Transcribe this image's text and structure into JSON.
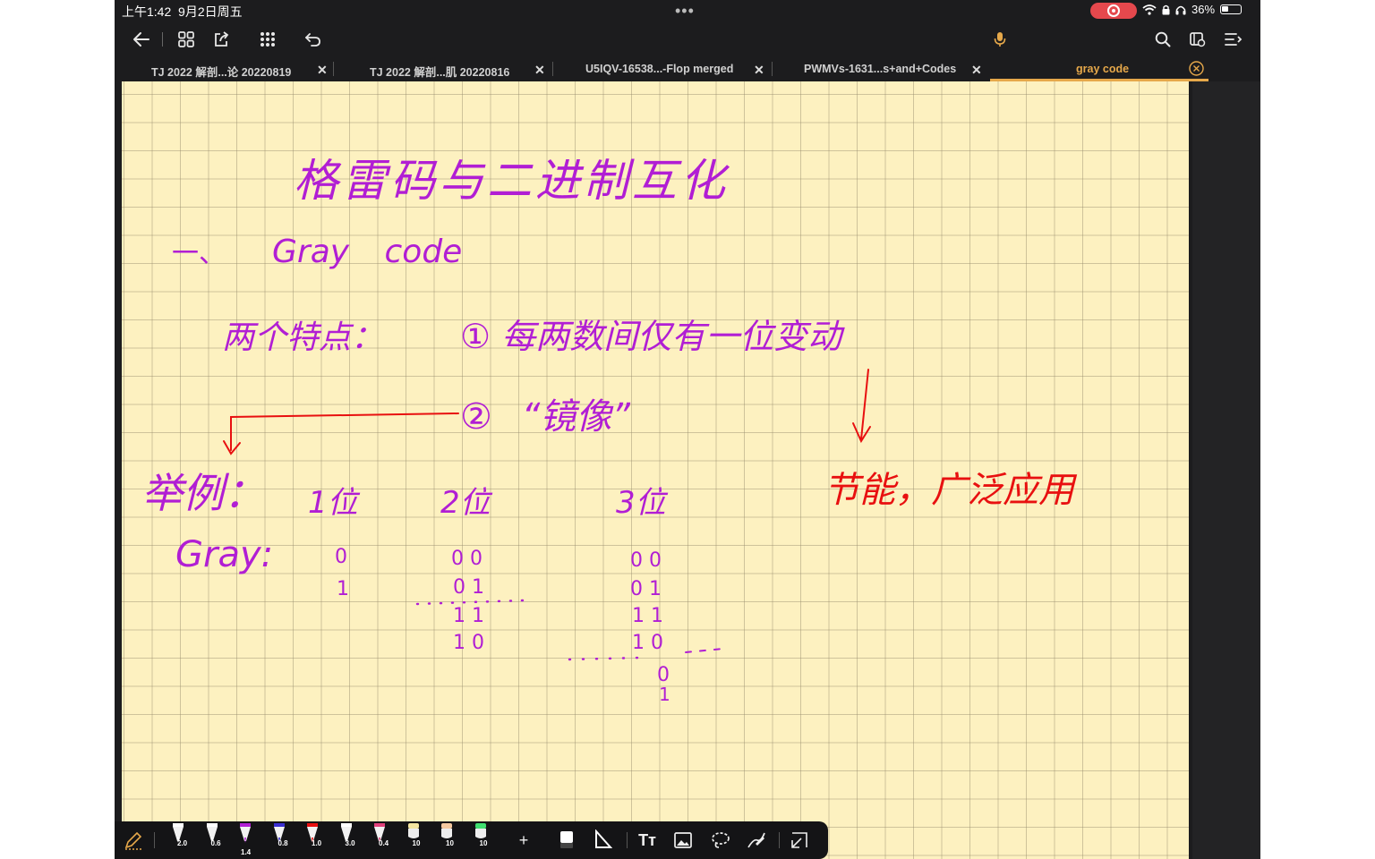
{
  "status_bar": {
    "time": "上午1:42",
    "date": "9月2日周五",
    "battery": "36%",
    "battery_level": 0.36
  },
  "toolbar": {
    "back_icon": "arrow-left-icon",
    "grid_icon": "grid-icon",
    "export_icon": "export-icon",
    "apps_icon": "apps-icon",
    "undo_icon": "undo-icon",
    "mic_icon": "microphone-icon",
    "search_icon": "search-icon",
    "bookmark_icon": "bookmark-icon",
    "menu_icon": "menu-icon"
  },
  "tabs": [
    {
      "label": "TJ 2022 解剖...论 20220819"
    },
    {
      "label": "TJ 2022 解剖...肌 20220816"
    },
    {
      "label": "U5IQV-16538...-Flop merged"
    },
    {
      "label": "PWMVs-1631...s+and+Codes"
    },
    {
      "label": "gray code",
      "active": true
    }
  ],
  "tab_count": "5",
  "colors": {
    "accent": "#e6a84a",
    "ink_purple": "#b11ed4",
    "ink_red": "#e81010",
    "paper": "#fdf1c0"
  },
  "note": {
    "title": "格雷码与二进制互化",
    "heading_num": "一、",
    "heading": "Gray code",
    "features_label": "两个特点：",
    "feature1": "① 每两数间仅有一位变动",
    "feature2": "② “镜像”",
    "red_note": "节能，广泛应用",
    "example_label": "举例：",
    "gray_label": "Gray:",
    "col1_header": "1位",
    "col2_header": "2位",
    "col3_header": "3位",
    "col1_rows": [
      "0",
      "1"
    ],
    "col2_rows": [
      "0 0",
      "0 1",
      "1 1",
      "1 0"
    ],
    "col3_rows": [
      "0 0",
      "0 1",
      "1 1",
      "1 0"
    ],
    "col3_extra": [
      "0",
      "1"
    ]
  },
  "palette": {
    "pens": [
      {
        "size": "2.0",
        "color": "#ffffff"
      },
      {
        "size": "0.6",
        "color": "#ffffff"
      },
      {
        "size": "1.4",
        "color": "#b11ed4"
      },
      {
        "size": "0.8",
        "color": "#3a2fd0"
      },
      {
        "size": "1.0",
        "color": "#e81010"
      },
      {
        "size": "3.0",
        "color": "#ffffff"
      },
      {
        "size": "0.4",
        "color": "#e0407a"
      },
      {
        "size": "10",
        "color": "#f5e6a0"
      },
      {
        "size": "10",
        "color": "#f5c9a0"
      },
      {
        "size": "10",
        "color": "#40e070"
      }
    ],
    "add_icon": "plus-icon",
    "eraser_icon": "eraser-icon",
    "ruler_icon": "ruler-icon",
    "text_icon": "text-icon",
    "image_icon": "image-icon",
    "lasso_icon": "lasso-icon",
    "shape_icon": "shape-icon",
    "collapse_icon": "collapse-icon"
  }
}
